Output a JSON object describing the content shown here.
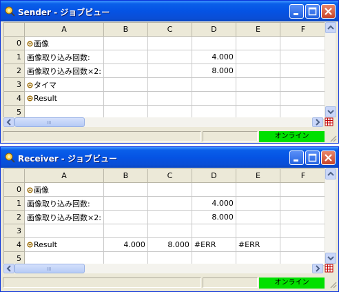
{
  "windows": [
    {
      "title": "Sender - ジョブビュー",
      "columns": [
        "A",
        "B",
        "C",
        "D",
        "E",
        "F"
      ],
      "rows": [
        {
          "num": "0",
          "cells": [
            {
              "text": "画像",
              "icon": "link"
            },
            {
              "text": ""
            },
            {
              "text": ""
            },
            {
              "text": ""
            },
            {
              "text": ""
            },
            {
              "text": ""
            }
          ]
        },
        {
          "num": "1",
          "cells": [
            {
              "text": "画像取り込み回数:"
            },
            {
              "text": ""
            },
            {
              "text": ""
            },
            {
              "text": "4.000",
              "num": true
            },
            {
              "text": ""
            },
            {
              "text": ""
            }
          ]
        },
        {
          "num": "2",
          "cells": [
            {
              "text": "画像取り込み回数×2:"
            },
            {
              "text": ""
            },
            {
              "text": ""
            },
            {
              "text": "8.000",
              "num": true
            },
            {
              "text": ""
            },
            {
              "text": ""
            }
          ]
        },
        {
          "num": "3",
          "cells": [
            {
              "text": "タイマ",
              "icon": "link"
            },
            {
              "text": ""
            },
            {
              "text": ""
            },
            {
              "text": ""
            },
            {
              "text": ""
            },
            {
              "text": ""
            }
          ]
        },
        {
          "num": "4",
          "cells": [
            {
              "text": "Result",
              "icon": "link"
            },
            {
              "text": ""
            },
            {
              "text": ""
            },
            {
              "text": ""
            },
            {
              "text": ""
            },
            {
              "text": ""
            }
          ]
        },
        {
          "num": "5",
          "cells": [
            {
              "text": ""
            },
            {
              "text": ""
            },
            {
              "text": ""
            },
            {
              "text": ""
            },
            {
              "text": ""
            },
            {
              "text": ""
            }
          ]
        }
      ],
      "status": "オンライン",
      "scroll_grip": "III"
    },
    {
      "title": "Receiver - ジョブビュー",
      "columns": [
        "A",
        "B",
        "C",
        "D",
        "E",
        "F"
      ],
      "rows": [
        {
          "num": "0",
          "cells": [
            {
              "text": "画像",
              "icon": "link"
            },
            {
              "text": ""
            },
            {
              "text": ""
            },
            {
              "text": ""
            },
            {
              "text": ""
            },
            {
              "text": ""
            }
          ]
        },
        {
          "num": "1",
          "cells": [
            {
              "text": "画像取り込み回数:"
            },
            {
              "text": ""
            },
            {
              "text": ""
            },
            {
              "text": "4.000",
              "num": true
            },
            {
              "text": ""
            },
            {
              "text": ""
            }
          ]
        },
        {
          "num": "2",
          "cells": [
            {
              "text": "画像取り込み回数×2:"
            },
            {
              "text": ""
            },
            {
              "text": ""
            },
            {
              "text": "8.000",
              "num": true
            },
            {
              "text": ""
            },
            {
              "text": ""
            }
          ]
        },
        {
          "num": "3",
          "cells": [
            {
              "text": ""
            },
            {
              "text": ""
            },
            {
              "text": ""
            },
            {
              "text": ""
            },
            {
              "text": ""
            },
            {
              "text": ""
            }
          ]
        },
        {
          "num": "4",
          "cells": [
            {
              "text": "Result",
              "icon": "link"
            },
            {
              "text": "4.000",
              "num": true
            },
            {
              "text": "8.000",
              "num": true
            },
            {
              "text": "#ERR"
            },
            {
              "text": "#ERR"
            },
            {
              "text": ""
            }
          ]
        },
        {
          "num": "5",
          "cells": [
            {
              "text": ""
            },
            {
              "text": ""
            },
            {
              "text": ""
            },
            {
              "text": ""
            },
            {
              "text": ""
            },
            {
              "text": ""
            }
          ]
        }
      ],
      "status": "オンライン",
      "scroll_grip": "III"
    }
  ],
  "colors": {
    "titlebar": "#0553e4",
    "online": "#00e000",
    "header_bg": "#ece9d8",
    "cell_icon": "#9a6a00"
  },
  "icons": {
    "app": "gear-magnifier-icon",
    "cell_link": "link-icon",
    "minimize": "minimize-icon",
    "maximize": "maximize-icon",
    "close": "close-icon"
  }
}
